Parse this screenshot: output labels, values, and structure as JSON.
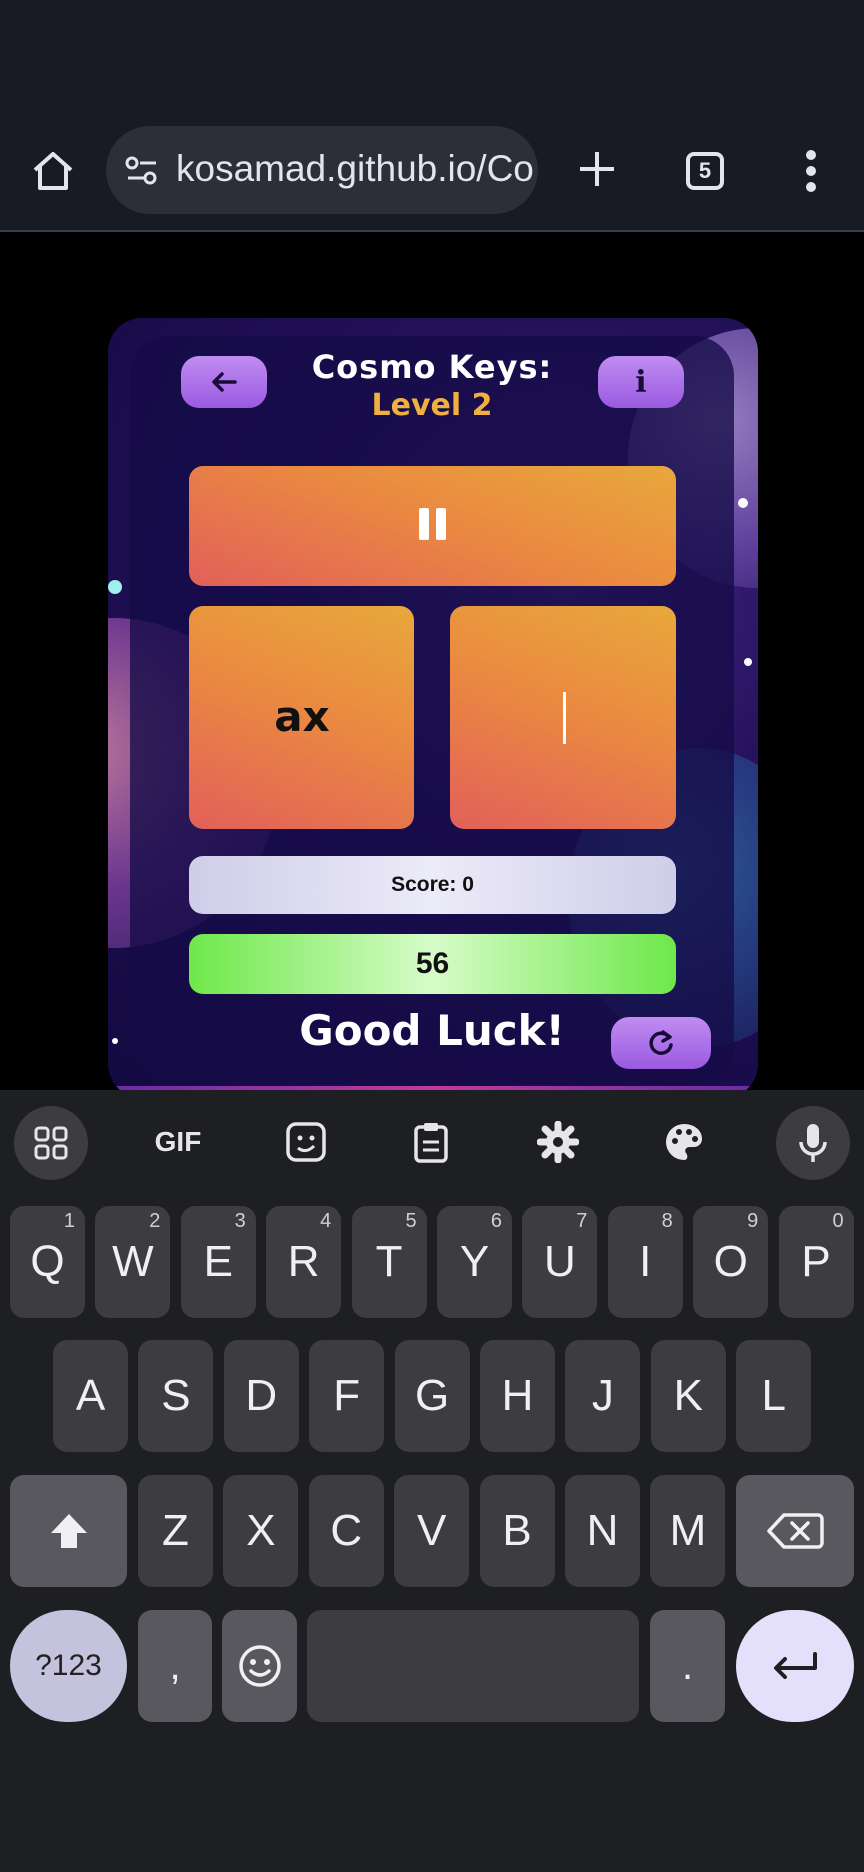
{
  "browser": {
    "url": "kosamad.github.io/Co",
    "tab_count": "5"
  },
  "game": {
    "title": "Cosmo Keys:",
    "level": "Level 2",
    "target_word": "ax",
    "typed_text": "",
    "score_label": "Score: 0",
    "timer": "56",
    "message": "Good Luck!"
  },
  "keyboard": {
    "toolbar": [
      "apps-icon",
      "gif",
      "sticker-icon",
      "clipboard-icon",
      "settings-icon",
      "palette-icon",
      "mic-icon"
    ],
    "gif_label": "GIF",
    "row1": [
      {
        "k": "Q",
        "h": "1"
      },
      {
        "k": "W",
        "h": "2"
      },
      {
        "k": "E",
        "h": "3"
      },
      {
        "k": "R",
        "h": "4"
      },
      {
        "k": "T",
        "h": "5"
      },
      {
        "k": "Y",
        "h": "6"
      },
      {
        "k": "U",
        "h": "7"
      },
      {
        "k": "I",
        "h": "8"
      },
      {
        "k": "O",
        "h": "9"
      },
      {
        "k": "P",
        "h": "0"
      }
    ],
    "row2": [
      "A",
      "S",
      "D",
      "F",
      "G",
      "H",
      "J",
      "K",
      "L"
    ],
    "row3": [
      "Z",
      "X",
      "C",
      "V",
      "B",
      "N",
      "M"
    ],
    "symbols_label": "?123",
    "comma_label": ",",
    "period_label": "."
  }
}
